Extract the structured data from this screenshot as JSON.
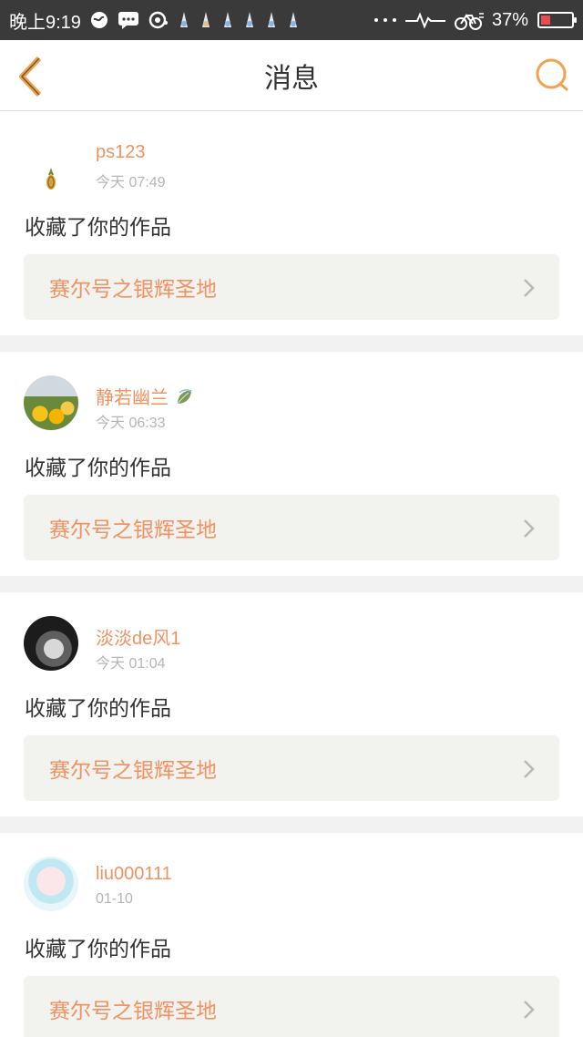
{
  "status": {
    "time": "晚上9:19",
    "battery": "37%"
  },
  "nav": {
    "title": "消息"
  },
  "colors": {
    "accent": "#f09262",
    "nav_icon": "#f2a24e"
  },
  "items": [
    {
      "name": "ps123",
      "time": "今天 07:49",
      "action": "收藏了你的作品",
      "work": "赛尔号之银辉圣地"
    },
    {
      "name": "静若幽兰",
      "time": "今天 06:33",
      "action": "收藏了你的作品",
      "work": "赛尔号之银辉圣地"
    },
    {
      "name": "淡淡de风1",
      "time": "今天 01:04",
      "action": "收藏了你的作品",
      "work": "赛尔号之银辉圣地"
    },
    {
      "name": "liu000111",
      "time": "01-10",
      "action": "收藏了你的作品",
      "work": "赛尔号之银辉圣地"
    }
  ]
}
